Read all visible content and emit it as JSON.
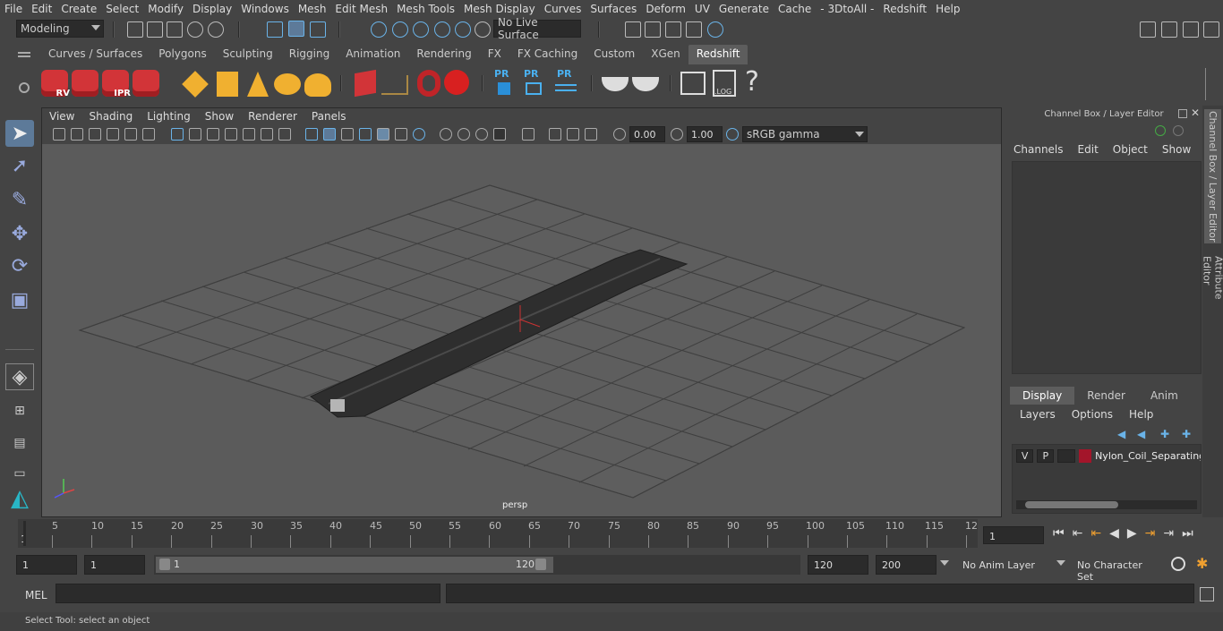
{
  "menubar": [
    "File",
    "Edit",
    "Create",
    "Select",
    "Modify",
    "Display",
    "Windows",
    "Mesh",
    "Edit Mesh",
    "Mesh Tools",
    "Mesh Display",
    "Curves",
    "Surfaces",
    "Deform",
    "UV",
    "Generate",
    "Cache",
    "- 3DtoAll -",
    "Redshift",
    "Help"
  ],
  "status_line": {
    "mode": "Modeling",
    "live_surface": "No Live Surface"
  },
  "shelf_tabs": [
    "Curves / Surfaces",
    "Polygons",
    "Sculpting",
    "Rigging",
    "Animation",
    "Rendering",
    "FX",
    "FX Caching",
    "Custom",
    "XGen",
    "Redshift"
  ],
  "active_shelf_tab": "Redshift",
  "shelf_icons": {
    "rv": "RV",
    "ipr": "IPR",
    "pr": "PR",
    "log": ".LOG",
    "help": "?"
  },
  "viewport": {
    "menu": [
      "View",
      "Shading",
      "Lighting",
      "Show",
      "Renderer",
      "Panels"
    ],
    "exposure": "0.00",
    "gamma": "1.00",
    "color_space": "sRGB gamma",
    "camera_label": "persp"
  },
  "channel_box": {
    "title": "Channel Box / Layer Editor",
    "menu": [
      "Channels",
      "Edit",
      "Object",
      "Show"
    ]
  },
  "layer_editor": {
    "tabs": [
      "Display",
      "Render",
      "Anim"
    ],
    "active_tab": "Display",
    "menu": [
      "Layers",
      "Options",
      "Help"
    ],
    "layer": {
      "v": "V",
      "p": "P",
      "name": "Nylon_Coil_Separating",
      "color": "#a3152a"
    }
  },
  "side_tabs": [
    "Channel Box / Layer Editor",
    "Attribute Editor"
  ],
  "timeline": {
    "labels": [
      "5",
      "10",
      "15",
      "20",
      "25",
      "30",
      "35",
      "40",
      "45",
      "50",
      "55",
      "60",
      "65",
      "70",
      "75",
      "80",
      "85",
      "90",
      "95",
      "100",
      "105",
      "110",
      "115",
      "12"
    ],
    "start_mark": "1",
    "current_frame": "1"
  },
  "range": {
    "start": "1",
    "playback_start": "1",
    "slider_start": "1",
    "slider_end": "120",
    "playback_end": "120",
    "end": "200",
    "anim_layer": "No Anim Layer",
    "character_set": "No Character Set"
  },
  "command_line": {
    "label": "MEL"
  },
  "status_text": "Select Tool: select an object"
}
